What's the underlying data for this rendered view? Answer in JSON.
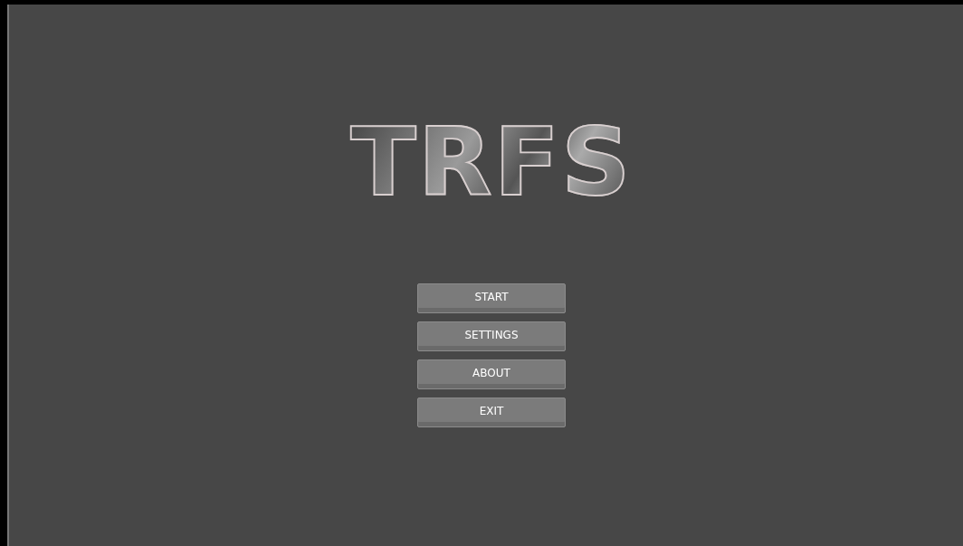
{
  "logo": {
    "text": "TRFS"
  },
  "menu": [
    {
      "label": "START"
    },
    {
      "label": "SETTINGS"
    },
    {
      "label": "ABOUT"
    },
    {
      "label": "EXIT"
    }
  ]
}
